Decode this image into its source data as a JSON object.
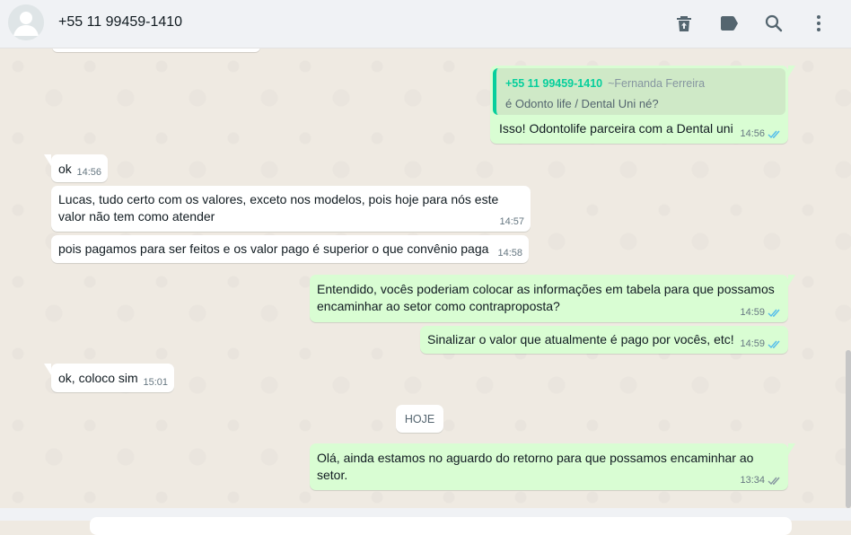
{
  "header": {
    "contact_name": "+55 11 99459-1410",
    "icons": [
      "delete-icon",
      "label-icon",
      "search-icon",
      "menu-icon"
    ]
  },
  "colors": {
    "outgoing_bubble": "#d9fdd3",
    "incoming_bubble": "#ffffff",
    "read_ticks": "#53bdeb",
    "quote_accent": "#06cf9c"
  },
  "messages": [
    {
      "direction": "out",
      "quoted_author": "+55 11 99459-1410",
      "quoted_alias": "~Fernanda Ferreira",
      "quoted_text": "é Odonto life / Dental Uni né?",
      "text": "Isso! Odontolife parceira com a Dental uni",
      "time": "14:56",
      "status": "read"
    },
    {
      "direction": "in",
      "text": "ok",
      "time": "14:56"
    },
    {
      "direction": "in",
      "text": "Lucas, tudo certo com os valores, exceto nos modelos, pois hoje para nós este valor não tem como atender",
      "time": "14:57"
    },
    {
      "direction": "in",
      "text": "pois pagamos para ser feitos e os valor pago é superior o que convênio paga",
      "time": "14:58"
    },
    {
      "direction": "out",
      "text": "Entendido, vocês poderiam colocar as informações em tabela para que possamos encaminhar ao setor como contraproposta?",
      "time": "14:59",
      "status": "read"
    },
    {
      "direction": "out",
      "text": "Sinalizar o valor que atualmente é pago por vocês, etc!",
      "time": "14:59",
      "status": "read"
    },
    {
      "direction": "in",
      "text": "ok, coloco sim",
      "time": "15:01"
    },
    {
      "direction": "out",
      "text": "Olá, ainda estamos no aguardo do retorno para que possamos encaminhar ao setor.",
      "time": "13:34",
      "status": "delivered"
    }
  ],
  "day_divider": "HOJE"
}
